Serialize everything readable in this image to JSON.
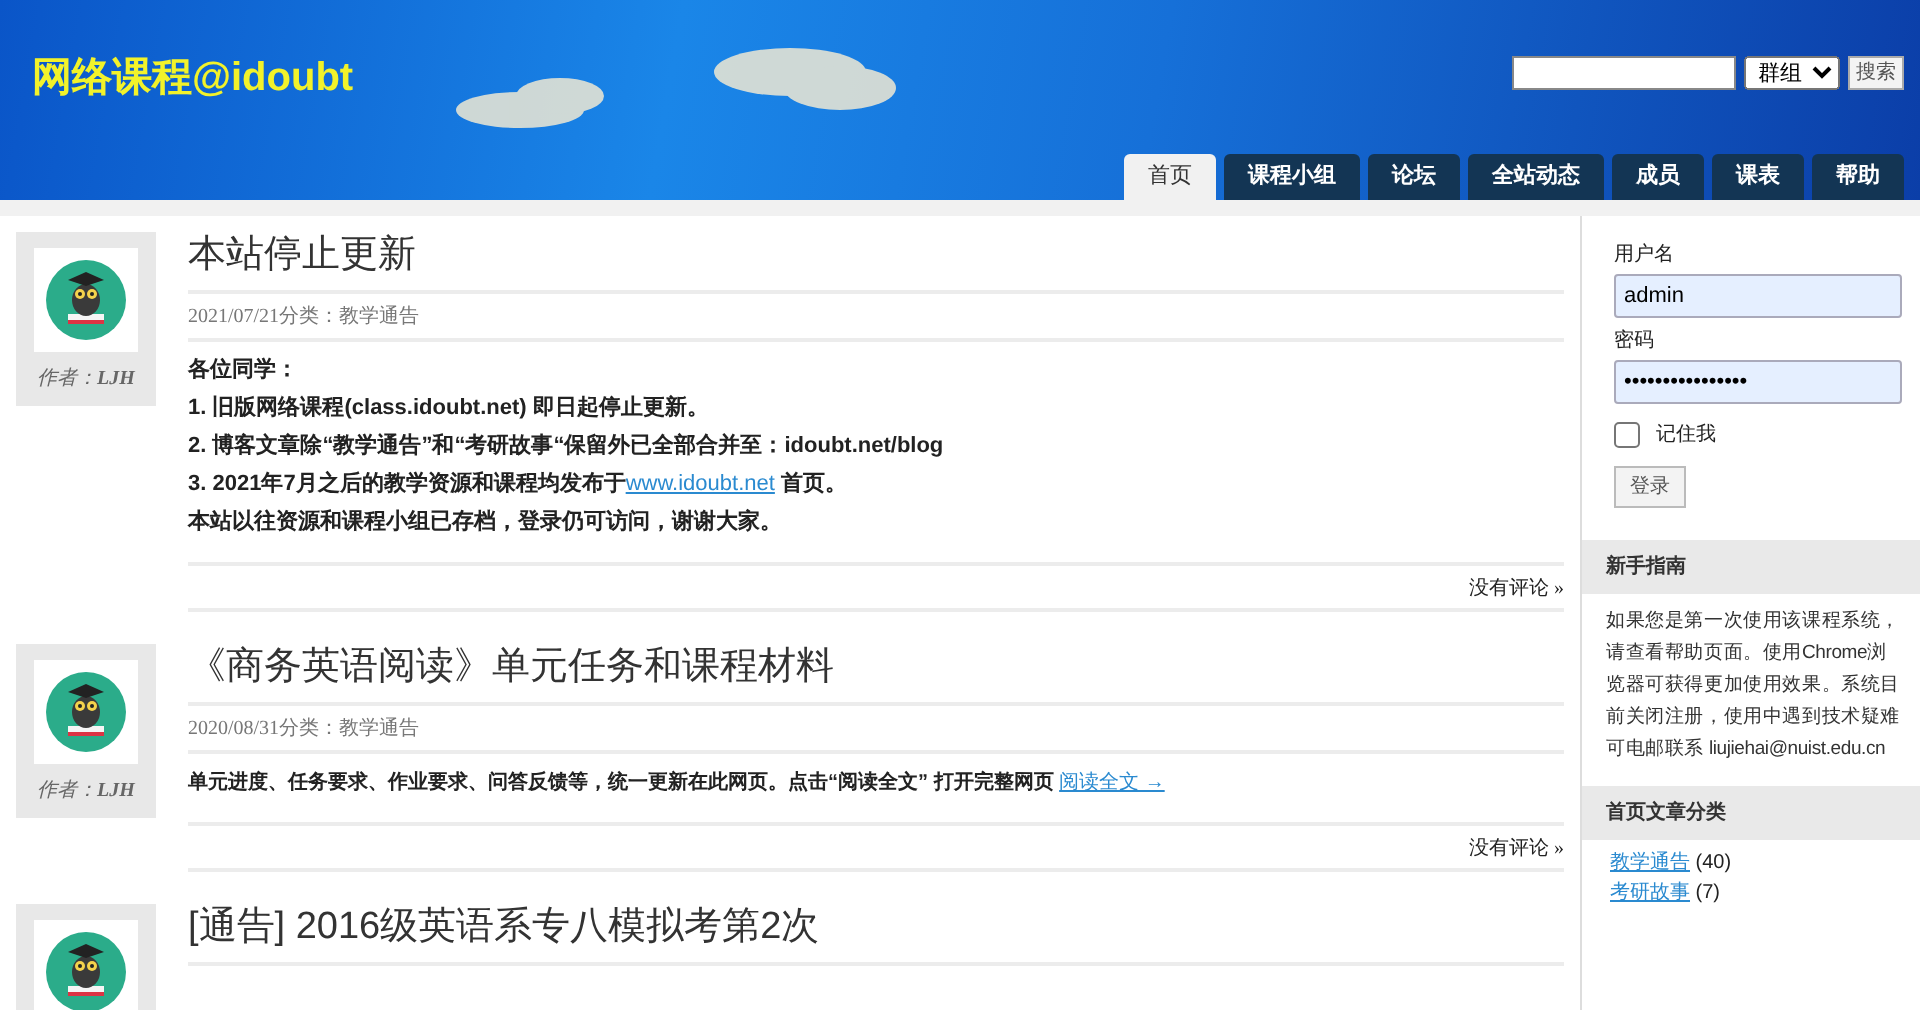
{
  "header": {
    "site_title": "网络课程@idoubt",
    "scope_select": {
      "value": "群组"
    },
    "search_button": "搜索"
  },
  "nav_tabs": [
    {
      "label": "首页",
      "selected": true
    },
    {
      "label": "课程小组",
      "selected": false
    },
    {
      "label": "论坛",
      "selected": false
    },
    {
      "label": "全站动态",
      "selected": false
    },
    {
      "label": "成员",
      "selected": false
    },
    {
      "label": "课表",
      "selected": false
    },
    {
      "label": "帮助",
      "selected": false
    }
  ],
  "posts": [
    {
      "title": "本站停止更新",
      "author_label": "作者：",
      "author": "LJH",
      "date": "2021/07/21",
      "category_label": "分类：",
      "category": "教学通告",
      "body": [
        {
          "kind": "bold",
          "text": "各位同学："
        },
        {
          "kind": "bold",
          "text": "1. 旧版网络课程(class.idoubt.net) 即日起停止更新。"
        },
        {
          "kind": "bold",
          "text": "2. 博客文章除“教学通告”和“考研故事“保留外已全部合并至：idoubt.net/blog"
        },
        {
          "kind": "link",
          "before": "3. 2021年7月之后的教学资源和课程均发布于",
          "link": "www.idoubt.net",
          "after": " 首页。"
        },
        {
          "kind": "bold",
          "text": "本站以往资源和课程小组已存档，登录仍可访问，谢谢大家。"
        }
      ],
      "comments": "没有评论 »"
    },
    {
      "title": "《商务英语阅读》单元任务和课程材料",
      "author_label": "作者：",
      "author": "LJH",
      "date": "2020/08/31",
      "category_label": "分类：",
      "category": "教学通告",
      "body": [
        {
          "kind": "small_link",
          "before": "单元进度、任务要求、作业要求、问答反馈等，统一更新在此网页。点击“阅读全文” 打开完整网页 ",
          "link": "阅读全文 →"
        }
      ],
      "comments": "没有评论 »"
    },
    {
      "title": "[通告] 2016级英语系专八模拟考第2次"
    }
  ],
  "sidebar": {
    "login": {
      "fields": [
        {
          "label": "用户名",
          "value": "admin"
        },
        {
          "label": "密码",
          "value": "••••••••••••••••"
        }
      ],
      "remember": {
        "label": "记住我",
        "checked": false
      },
      "button": "登录"
    },
    "guide": {
      "heading": "新手指南",
      "text": "如果您是第一次使用该课程系统，请查看帮助页面。使用Chrome浏览器可获得更加使用效果。系统目前关闭注册，使用中遇到技术疑难可电邮联系 liujiehai@nuist.edu.cn"
    },
    "categories": {
      "heading": "首页文章分类",
      "items": [
        {
          "name": "教学通告",
          "count": "(40)"
        },
        {
          "name": "考研故事",
          "count": "(7)"
        }
      ]
    }
  }
}
